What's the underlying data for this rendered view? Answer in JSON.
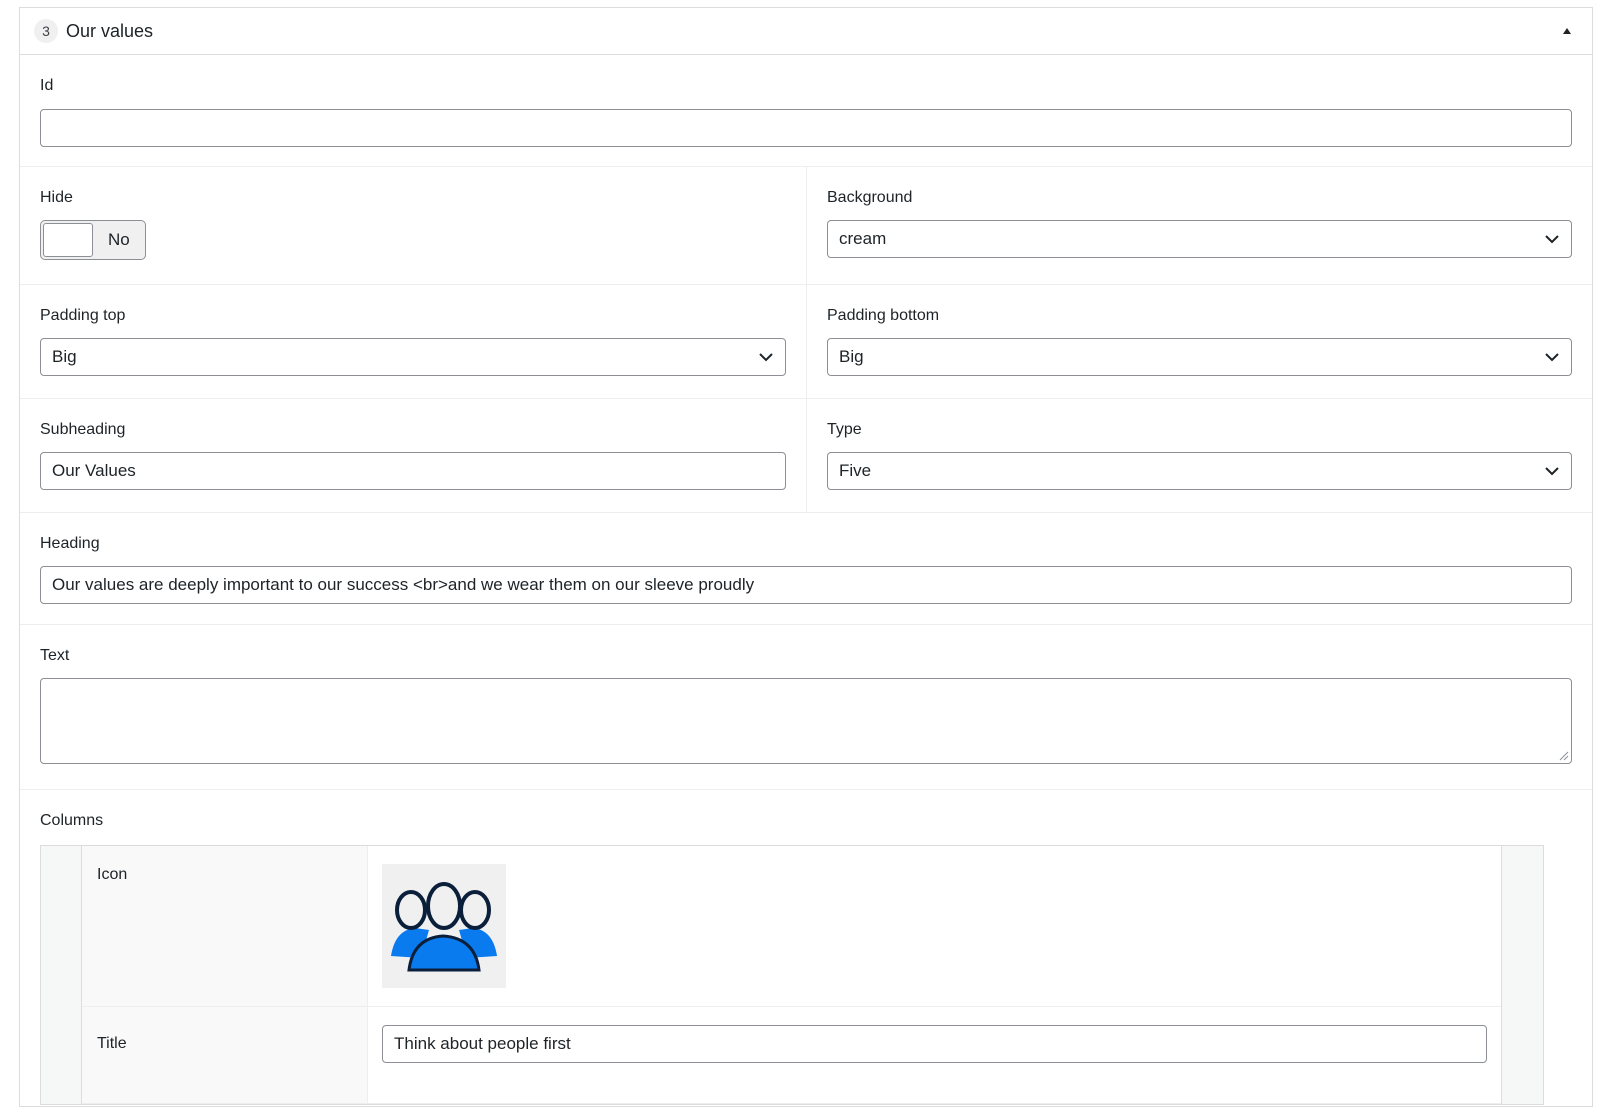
{
  "panel": {
    "order": "3",
    "title": "Our values"
  },
  "fields": {
    "id": {
      "label": "Id",
      "value": ""
    },
    "hide": {
      "label": "Hide",
      "state": "No"
    },
    "background": {
      "label": "Background",
      "value": "cream"
    },
    "padding_top": {
      "label": "Padding top",
      "value": "Big"
    },
    "padding_bottom": {
      "label": "Padding bottom",
      "value": "Big"
    },
    "subheading": {
      "label": "Subheading",
      "value": "Our Values"
    },
    "type": {
      "label": "Type",
      "value": "Five"
    },
    "heading": {
      "label": "Heading",
      "value": "Our values are deeply important to our success <br>and we wear them on our sleeve proudly"
    },
    "text": {
      "label": "Text",
      "value": ""
    },
    "columns": {
      "label": "Columns",
      "rows": [
        {
          "icon_label": "Icon",
          "icon_image": "people-group-icon"
        },
        {
          "title_label": "Title",
          "title_value": "Think about people first"
        }
      ]
    }
  },
  "colors": {
    "icon_blue": "#0a7bef",
    "icon_outline": "#0b1f3a",
    "border": "#8c8f94"
  }
}
